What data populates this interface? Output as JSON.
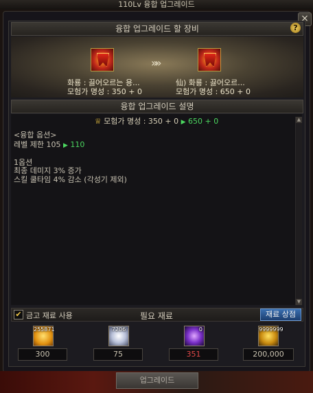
{
  "window": {
    "title": "110Lv 융합 업그레이드",
    "close_glyph": "×"
  },
  "equip_section": {
    "header": "융합 업그레이드 할 장비",
    "help_glyph": "?",
    "arrow_glyph": "»»",
    "source_item": {
      "name": "화룡 : 끓어오르는 용...",
      "fame": "모험가 명성 : 350 + 0"
    },
    "target_item": {
      "name": "仙) 화룡 : 끓어오르...",
      "fame": "모험가 명성 : 650 + 0"
    }
  },
  "desc_section": {
    "header": "융합 업그레이드 설명",
    "fame_change": {
      "prefix": "모험가 명성 : 350 + 0",
      "arrow": "▶",
      "after": "650 + 0"
    },
    "option_title": "<융합 옵션>",
    "level_limit": {
      "prefix": "레벨 제한 105",
      "arrow": "▶",
      "after": "110"
    },
    "option_label": "1옵션",
    "option_line1": "최종 데미지 3% 증가",
    "option_line2": "스킬 쿨타임 4% 감소 (각성기 제외)",
    "scroll_up": "▲",
    "scroll_down": "▼"
  },
  "materials": {
    "checkbox_label": "금고 재료 사용",
    "checkbox_glyph": "✔",
    "header": "필요 재료",
    "shop_button": "재료 상점",
    "items": [
      {
        "icon": "gem-crystal-icon",
        "stock": "255871",
        "required": "300",
        "required_color": "#c9c2b0"
      },
      {
        "icon": "white-orb-icon",
        "stock": "7206",
        "required": "75",
        "required_color": "#c9c2b0"
      },
      {
        "icon": "purple-orb-icon",
        "stock": "0",
        "required": "351",
        "required_color": "#e04848"
      },
      {
        "icon": "gold-coins-icon",
        "stock": "9999999",
        "required": "200,000",
        "required_color": "#c9c2b0"
      }
    ]
  },
  "upgrade_button": "업그레이드"
}
